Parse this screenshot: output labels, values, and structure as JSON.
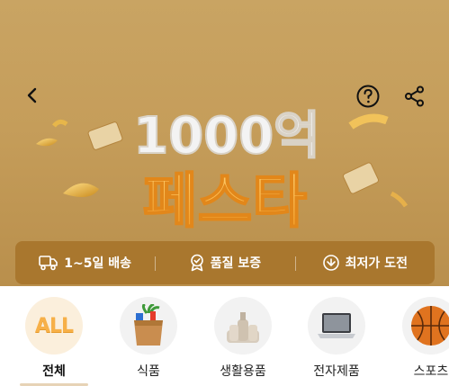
{
  "header": {
    "back_icon": "chevron-left-icon",
    "help_icon": "question-circle-icon",
    "share_icon": "share-icon"
  },
  "banner": {
    "title_top": "1000억",
    "title_main": "페스타",
    "colors": {
      "background": "#c59d5a",
      "title_top": "#f3f3f3",
      "title_main": "#f6b13f",
      "benefit_bar": "#a9772e"
    }
  },
  "benefits": [
    {
      "icon": "truck-icon",
      "label": "1~5일 배송"
    },
    {
      "icon": "badge-icon",
      "label": "품질 보증"
    },
    {
      "icon": "lowest-price-icon",
      "label": "최저가 도전"
    }
  ],
  "categories": [
    {
      "badge": "ALL",
      "label": "전체",
      "selected": true
    },
    {
      "icon": "grocery-bag-icon",
      "label": "식품"
    },
    {
      "icon": "household-bottles-icon",
      "label": "생활용품"
    },
    {
      "icon": "laptop-icon",
      "label": "전자제품"
    },
    {
      "icon": "basketball-icon",
      "label": "스포츠"
    }
  ]
}
